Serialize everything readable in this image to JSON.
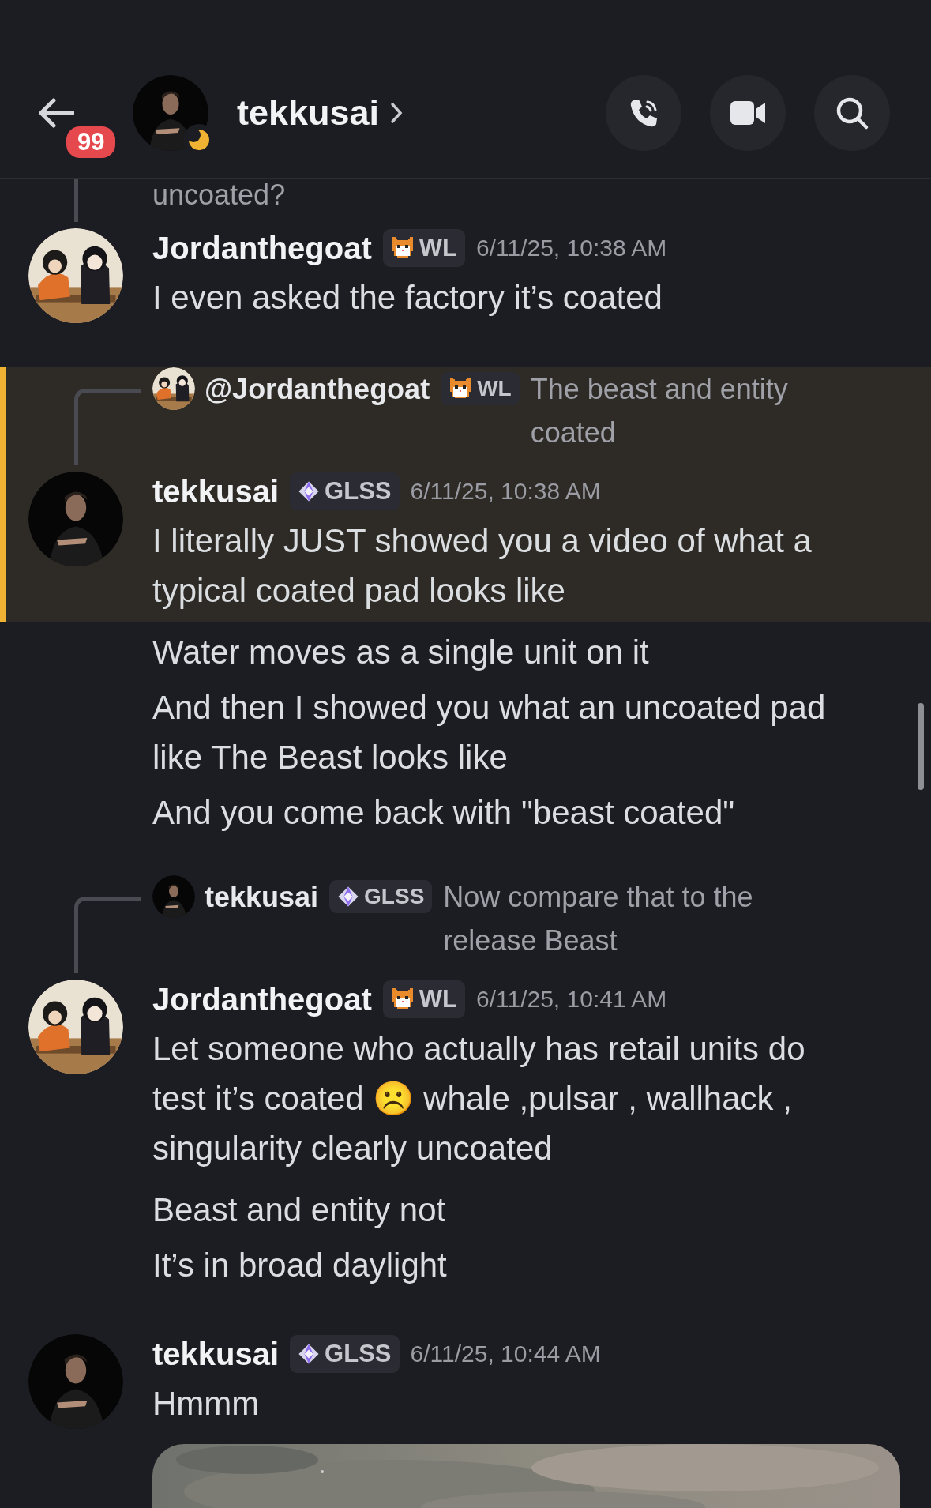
{
  "header": {
    "unread_badge": "99",
    "title": "tekkusai",
    "actions": [
      {
        "kind": "call"
      },
      {
        "kind": "video"
      },
      {
        "kind": "search"
      }
    ]
  },
  "messages": [
    {
      "kind": "message",
      "author": "Jordanthegoat",
      "tag": {
        "kind": "cat",
        "label": "WL"
      },
      "time": "6/11/25, 10:38 AM",
      "highlighted": false,
      "reply": {
        "text": "uncoated?"
      },
      "text": "I even asked the factory it’s coated"
    },
    {
      "kind": "message",
      "author": "tekkusai",
      "tag": {
        "kind": "gem",
        "label": "GLSS"
      },
      "time": "6/11/25, 10:38 AM",
      "highlighted": true,
      "reply": {
        "author": "@Jordanthegoat",
        "tag": {
          "kind": "cat",
          "label": "WL"
        },
        "text": "The beast and entity coated"
      },
      "text": "I literally JUST showed you a video of what a typical coated pad looks like"
    },
    {
      "kind": "continuation",
      "text": "Water moves as a single unit on it"
    },
    {
      "kind": "continuation",
      "text": "And then I showed you what an uncoated pad like The Beast looks like"
    },
    {
      "kind": "continuation",
      "text": "And you come back with \"beast coated\""
    },
    {
      "kind": "message",
      "author": "Jordanthegoat",
      "tag": {
        "kind": "cat",
        "label": "WL"
      },
      "time": "6/11/25, 10:41 AM",
      "highlighted": false,
      "reply": {
        "author": "tekkusai",
        "tag": {
          "kind": "gem",
          "label": "GLSS"
        },
        "text": "Now compare that to the release Beast"
      },
      "text": "Let someone who actually has retail units do test it’s coated ☹️  whale ,pulsar , wallhack , singularity clearly uncoated"
    },
    {
      "kind": "continuation",
      "text": "Beast and entity not"
    },
    {
      "kind": "continuation",
      "text": "It’s in broad daylight"
    },
    {
      "kind": "message",
      "author": "tekkusai",
      "tag": {
        "kind": "gem",
        "label": "GLSS"
      },
      "time": "6/11/25, 10:44 AM",
      "highlighted": false,
      "text": "Hmmm"
    }
  ]
}
